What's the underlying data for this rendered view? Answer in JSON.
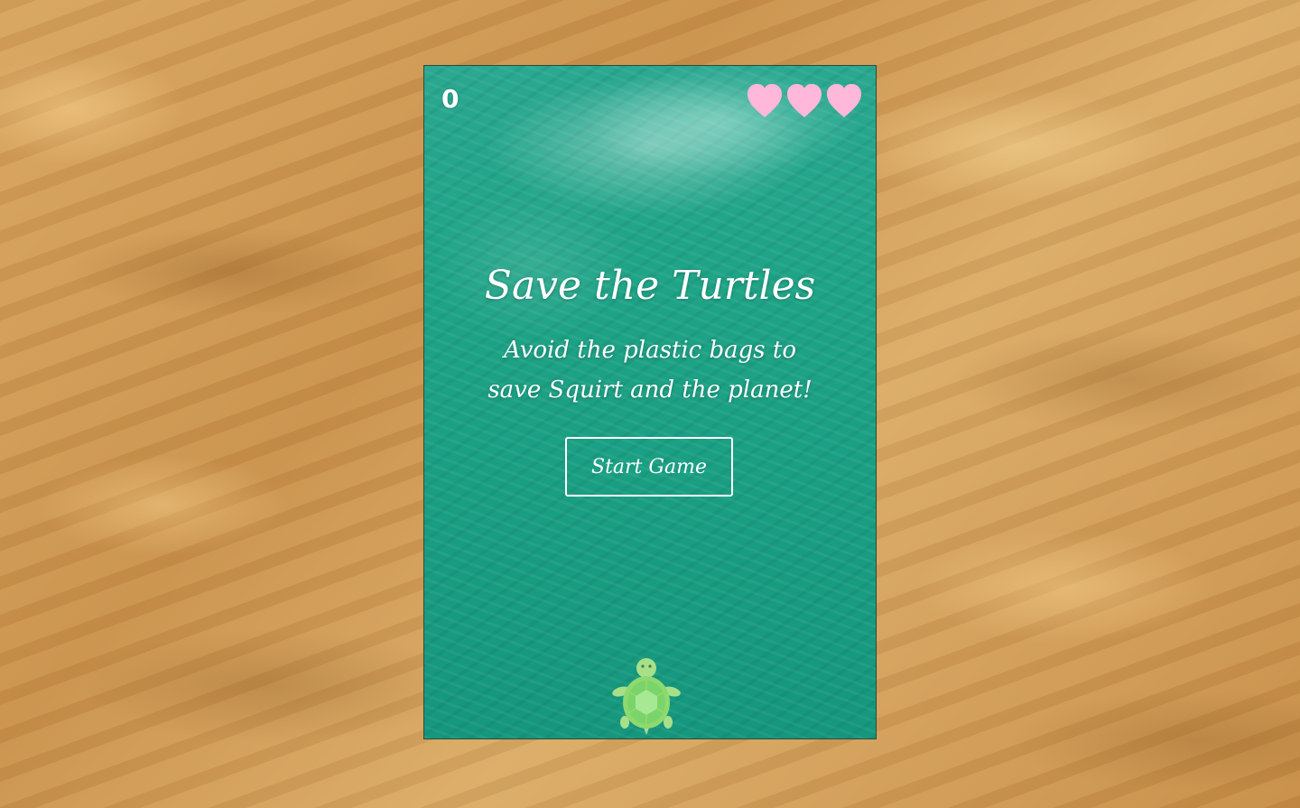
{
  "hud": {
    "score": "0",
    "lives": 3,
    "heart_color": "#ffb8d9"
  },
  "start_screen": {
    "title": "Save the Turtles",
    "subtitle": "Avoid the plastic bags to save Squirt and the planet!",
    "start_button_label": "Start Game"
  },
  "player": {
    "icon": "turtle-icon",
    "shell_color": "#7ad46a",
    "body_color": "#a8e08a"
  },
  "colors": {
    "ocean": "#1fa487",
    "sand": "#d6a45e",
    "text": "#ffffff"
  }
}
